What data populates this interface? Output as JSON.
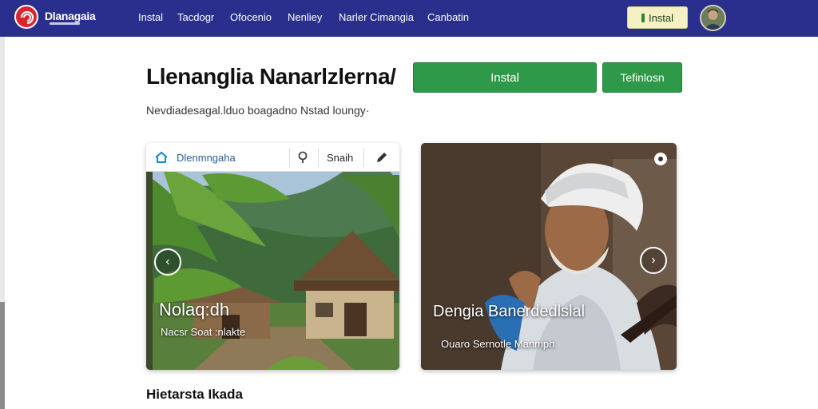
{
  "header": {
    "brand": "Dlanagaia",
    "nav": [
      "Instal",
      "Tacdogr",
      "Ofocenio",
      "Nenliey",
      "Narler Cimangia",
      "Canbatin"
    ],
    "install_label": "Instal"
  },
  "hero": {
    "title": "Llenanglia Nanarlzlerna/",
    "install_button": "Instal",
    "secondary_button": "Tefinlosn",
    "subtitle": "Nevdiadesagal.lduo boagadno Nstad loungy·"
  },
  "card_left": {
    "search_label": "Dlenmngaha",
    "search_text": "Snaih",
    "title": "Nolaq:dh",
    "subtitle": "Nacsr Soat :nlakte"
  },
  "card_right": {
    "title": "Dengia Banerdedlslal",
    "subtitle": "Ouaro Sernotle Manmph"
  },
  "section": {
    "title": "Hietarsta Ikada"
  },
  "colors": {
    "header_bg": "#2a2f8e",
    "primary_green": "#2e9a49",
    "install_top_bg": "#f6f1c4",
    "brand_red": "#d9252b"
  },
  "icons": [
    "brand-logo-icon",
    "home-icon",
    "search-icon",
    "pen-icon",
    "chevron-left-icon",
    "chevron-right-icon",
    "menu-dot-icon"
  ]
}
